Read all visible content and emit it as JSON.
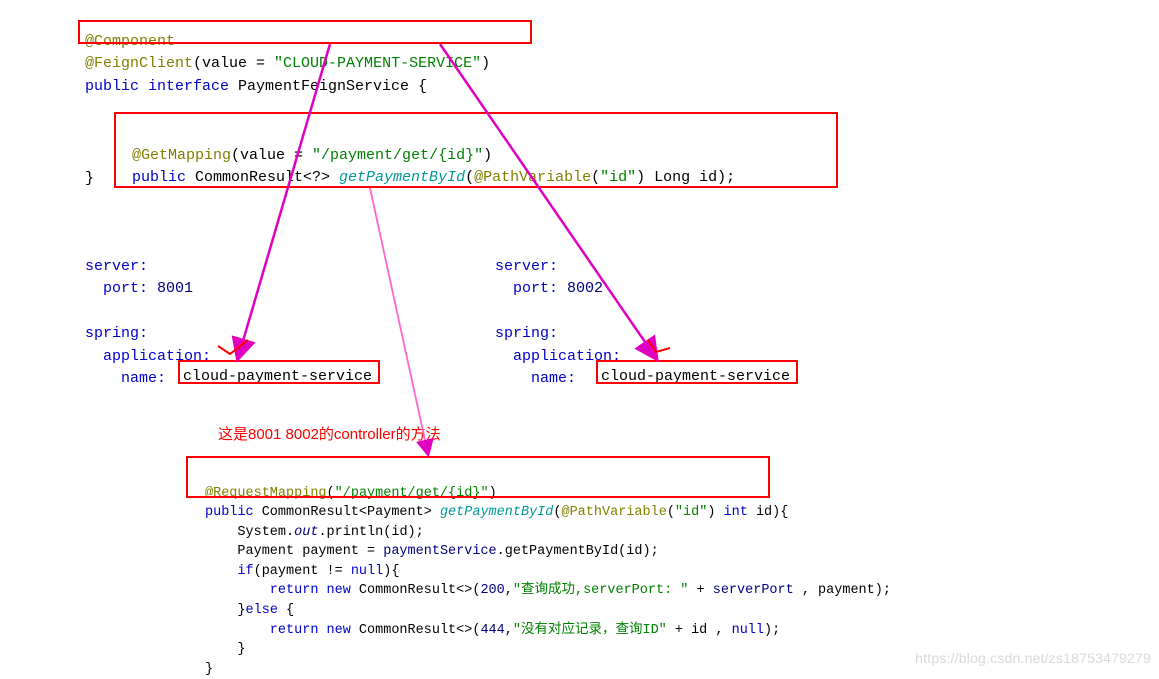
{
  "feign": {
    "component": "@Component",
    "feignClient": "@FeignClient",
    "valueEq": "(value = ",
    "serviceStr": "\"CLOUD-PAYMENT-SERVICE\"",
    "closeParen": ")",
    "publicInterface": "public interface",
    "ifaceName": " PaymentFeignService {",
    "getMapping": "@GetMapping",
    "gmValueEq": "(value = ",
    "gmPath": "\"/payment/get/{id}\"",
    "gmClose": ")",
    "publicKw": "public",
    "commonResultQ": " CommonResult<?> ",
    "getPaymentById": "getPaymentById",
    "open": "(",
    "pathVar": "@PathVariable",
    "pvArg": "(",
    "idStr": "\"id\"",
    "pvClose": ") Long id);",
    "closeBrace": "}"
  },
  "yaml1": {
    "server": "server:",
    "portKey": "  port:",
    "portVal": " 8001",
    "spring": "spring:",
    "app": "  application:",
    "nameKey": "    name:",
    "nameVal": "cloud-payment-service"
  },
  "yaml2": {
    "server": "server:",
    "portKey": "  port:",
    "portVal": " 8002",
    "spring": "spring:",
    "app": "  application:",
    "nameKey": "    name:",
    "nameVal": "cloud-payment-service"
  },
  "noteText": "这是8001 8002的controller的方法",
  "ctrl": {
    "requestMapping": "@RequestMapping",
    "rmOpen": "(",
    "rmPath": "\"/payment/get/{id}\"",
    "rmClose": ")",
    "publicKw": "public",
    "crPayment": " CommonResult<Payment> ",
    "getPaymentById": "getPaymentById",
    "open": "(",
    "pathVar": "@PathVariable",
    "pvOpen": "(",
    "idStr": "\"id\"",
    "pvClose": ") ",
    "intKw": "int",
    "idClose": " id){",
    "sout": "    System.",
    "out": "out",
    "println": ".println(id);",
    "pmtDecl": "    Payment payment = ",
    "pmtSvc": "paymentService",
    "pmtCall": ".getPaymentById(id);",
    "ifLine": "    if",
    "ifCond": "(payment != ",
    "nullKw": "null",
    "ifClose": "){",
    "ret1a": "        return new",
    "ret1b": " CommonResult<>(",
    "num200": "200",
    "ret1c": ",",
    "str1": "\"查询成功,serverPort: \"",
    "ret1d": " + ",
    "serverPort": "serverPort",
    "ret1e": " , payment);",
    "elseLine": "    }",
    "elseKw": "else",
    "elseOpen": " {",
    "ret2a": "        return new",
    "ret2b": " CommonResult<>(",
    "num444": "444",
    "ret2c": ",",
    "str2": "\"没有对应记录，查询ID\"",
    "ret2d": " + id , ",
    "null2": "null",
    "ret2e": ");",
    "close1": "    }",
    "close2": "}"
  },
  "watermark": "https://blog.csdn.net/zs18753479279"
}
